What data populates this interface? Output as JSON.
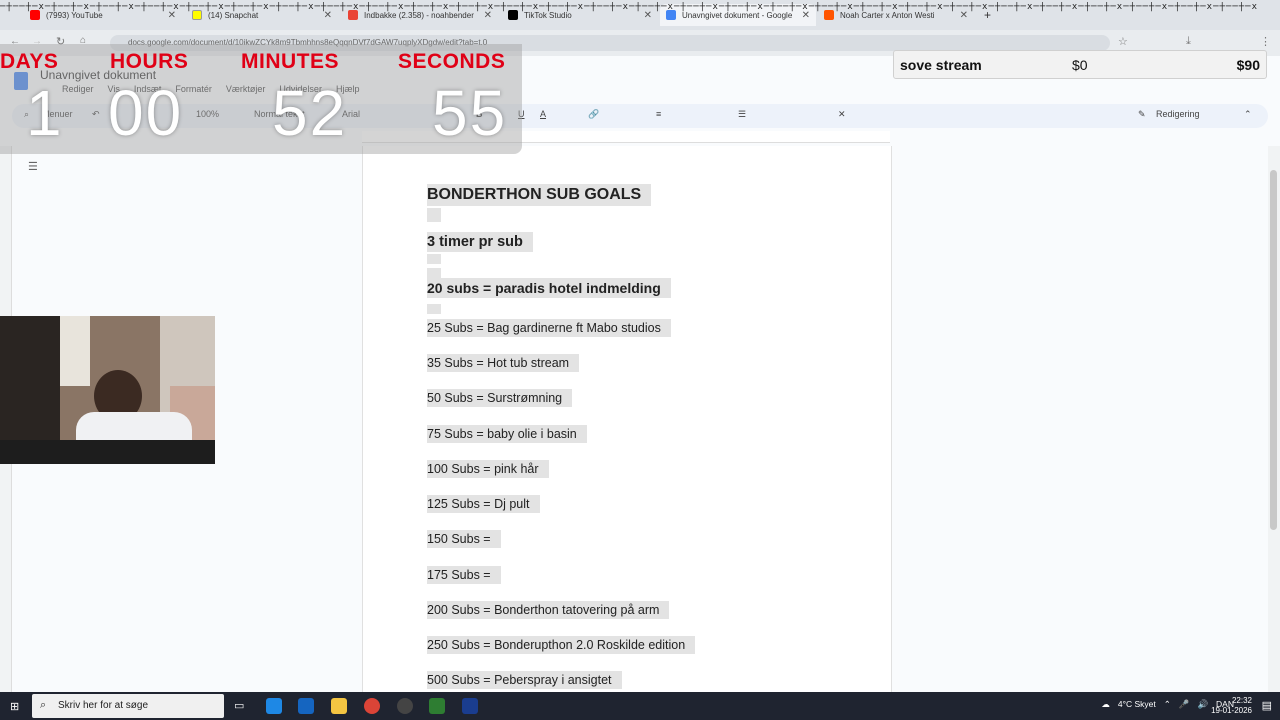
{
  "tabs": [
    {
      "title": "(7993) YouTube",
      "color": "#ff0000"
    },
    {
      "title": "(14) Snapchat",
      "color": "#fffc00"
    },
    {
      "title": "Indbakke (2.358) - noahbender",
      "color": "#ea4335"
    },
    {
      "title": "TikTok Studio",
      "color": "#000000"
    },
    {
      "title": "Unavngivet dokument - Google",
      "color": "#4285f4"
    },
    {
      "title": "Noah Carter x Anton Westi",
      "color": "#ff5500"
    }
  ],
  "address": {
    "url": "docs.google.com/document/d/10ikwZCYk8m9Tbmhhns8eQqqnDVf7dGAW7uqplyXDgdw/edit?tab=t.0"
  },
  "docs": {
    "title": "Unavngivet dokument",
    "menu": [
      "Rediger",
      "Vis",
      "Indsæt",
      "Formatér",
      "Værktøjer",
      "Udvidelser",
      "Hjælp"
    ],
    "toolbar": {
      "search": "Menuer",
      "zoom": "100%",
      "style": "Normal tekst",
      "font": "Arial",
      "mode": "Redigering"
    }
  },
  "document": {
    "lines": [
      "BONDERTHON SUB GOALS",
      "3 timer pr sub",
      "20 subs = paradis hotel indmelding",
      "25 Subs = Bag gardinerne ft Mabo studios",
      "35 Subs = Hot tub stream",
      "50 Subs = Surstrømning",
      "75 Subs = baby olie i basin",
      "100 Subs = pink hår",
      "125 Subs = Dj pult",
      "150 Subs =",
      "175 Subs =",
      "200 Subs = Bonderthon tatovering på arm",
      "250 Subs = Bonderupthon 2.0 Roskilde edition",
      "500 Subs = Peberspray i ansigtet"
    ]
  },
  "countdown": {
    "labels": {
      "days": "DAYS",
      "hours": "HOURS",
      "minutes": "MINUTES",
      "seconds": "SECONDS"
    },
    "values": {
      "days": "1",
      "hours": "00",
      "minutes": "52",
      "seconds": "55"
    },
    "label_color": "#e00016"
  },
  "goal": {
    "title": "sove stream",
    "current": "$0",
    "target": "$90"
  },
  "taskbar": {
    "search_placeholder": "Skriv her for at søge",
    "weather": "4°C Skyet",
    "language": "DAN",
    "time": "22:32",
    "date": "19-01-2026"
  }
}
